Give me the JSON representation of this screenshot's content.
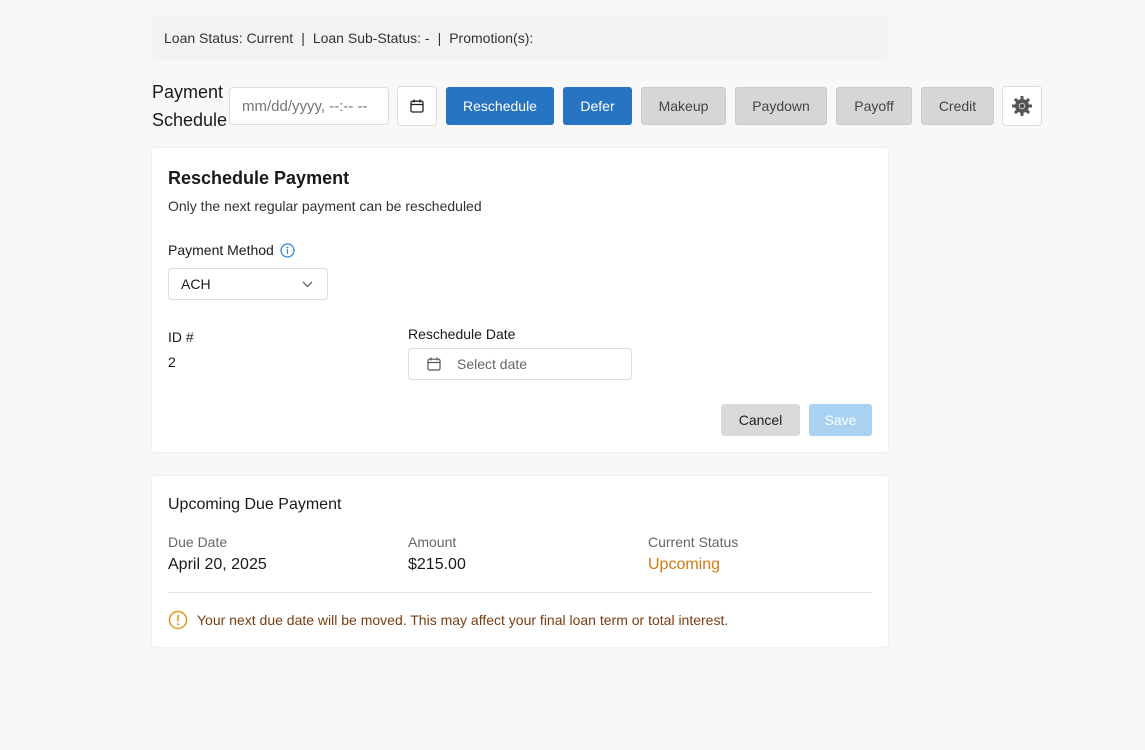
{
  "status_bar": {
    "loan_status": "Loan Status: Current",
    "sub_status": "Loan Sub-Status: -",
    "promotions": "Promotion(s):",
    "separator": "|"
  },
  "toolbar": {
    "title": "Payment Schedule",
    "datetime_placeholder": "mm/dd/yyyy, --:-- --",
    "buttons": {
      "reschedule": "Reschedule",
      "defer": "Defer",
      "makeup": "Makeup",
      "paydown": "Paydown",
      "payoff": "Payoff",
      "credit": "Credit"
    }
  },
  "reschedule_card": {
    "title": "Reschedule Payment",
    "subtitle": "Only the next regular payment can be rescheduled",
    "payment_method_label": "Payment Method",
    "payment_method_value": "ACH",
    "id_label": "ID #",
    "id_value": "2",
    "reschedule_date_label": "Reschedule Date",
    "reschedule_date_placeholder": "Select date",
    "cancel_label": "Cancel",
    "save_label": "Save"
  },
  "upcoming_card": {
    "title": "Upcoming Due Payment",
    "due_date_label": "Due Date",
    "due_date_value": "April 20, 2025",
    "amount_label": "Amount",
    "amount_value": "$215.00",
    "status_label": "Current Status",
    "status_value": "Upcoming",
    "warning": "Your next due date will be moved. This may affect your final loan term or total interest."
  },
  "colors": {
    "primary": "#2774c2",
    "save_disabled": "#a8d1f2",
    "warning_orange": "#d07a10",
    "warning_text": "#7a3d12"
  }
}
